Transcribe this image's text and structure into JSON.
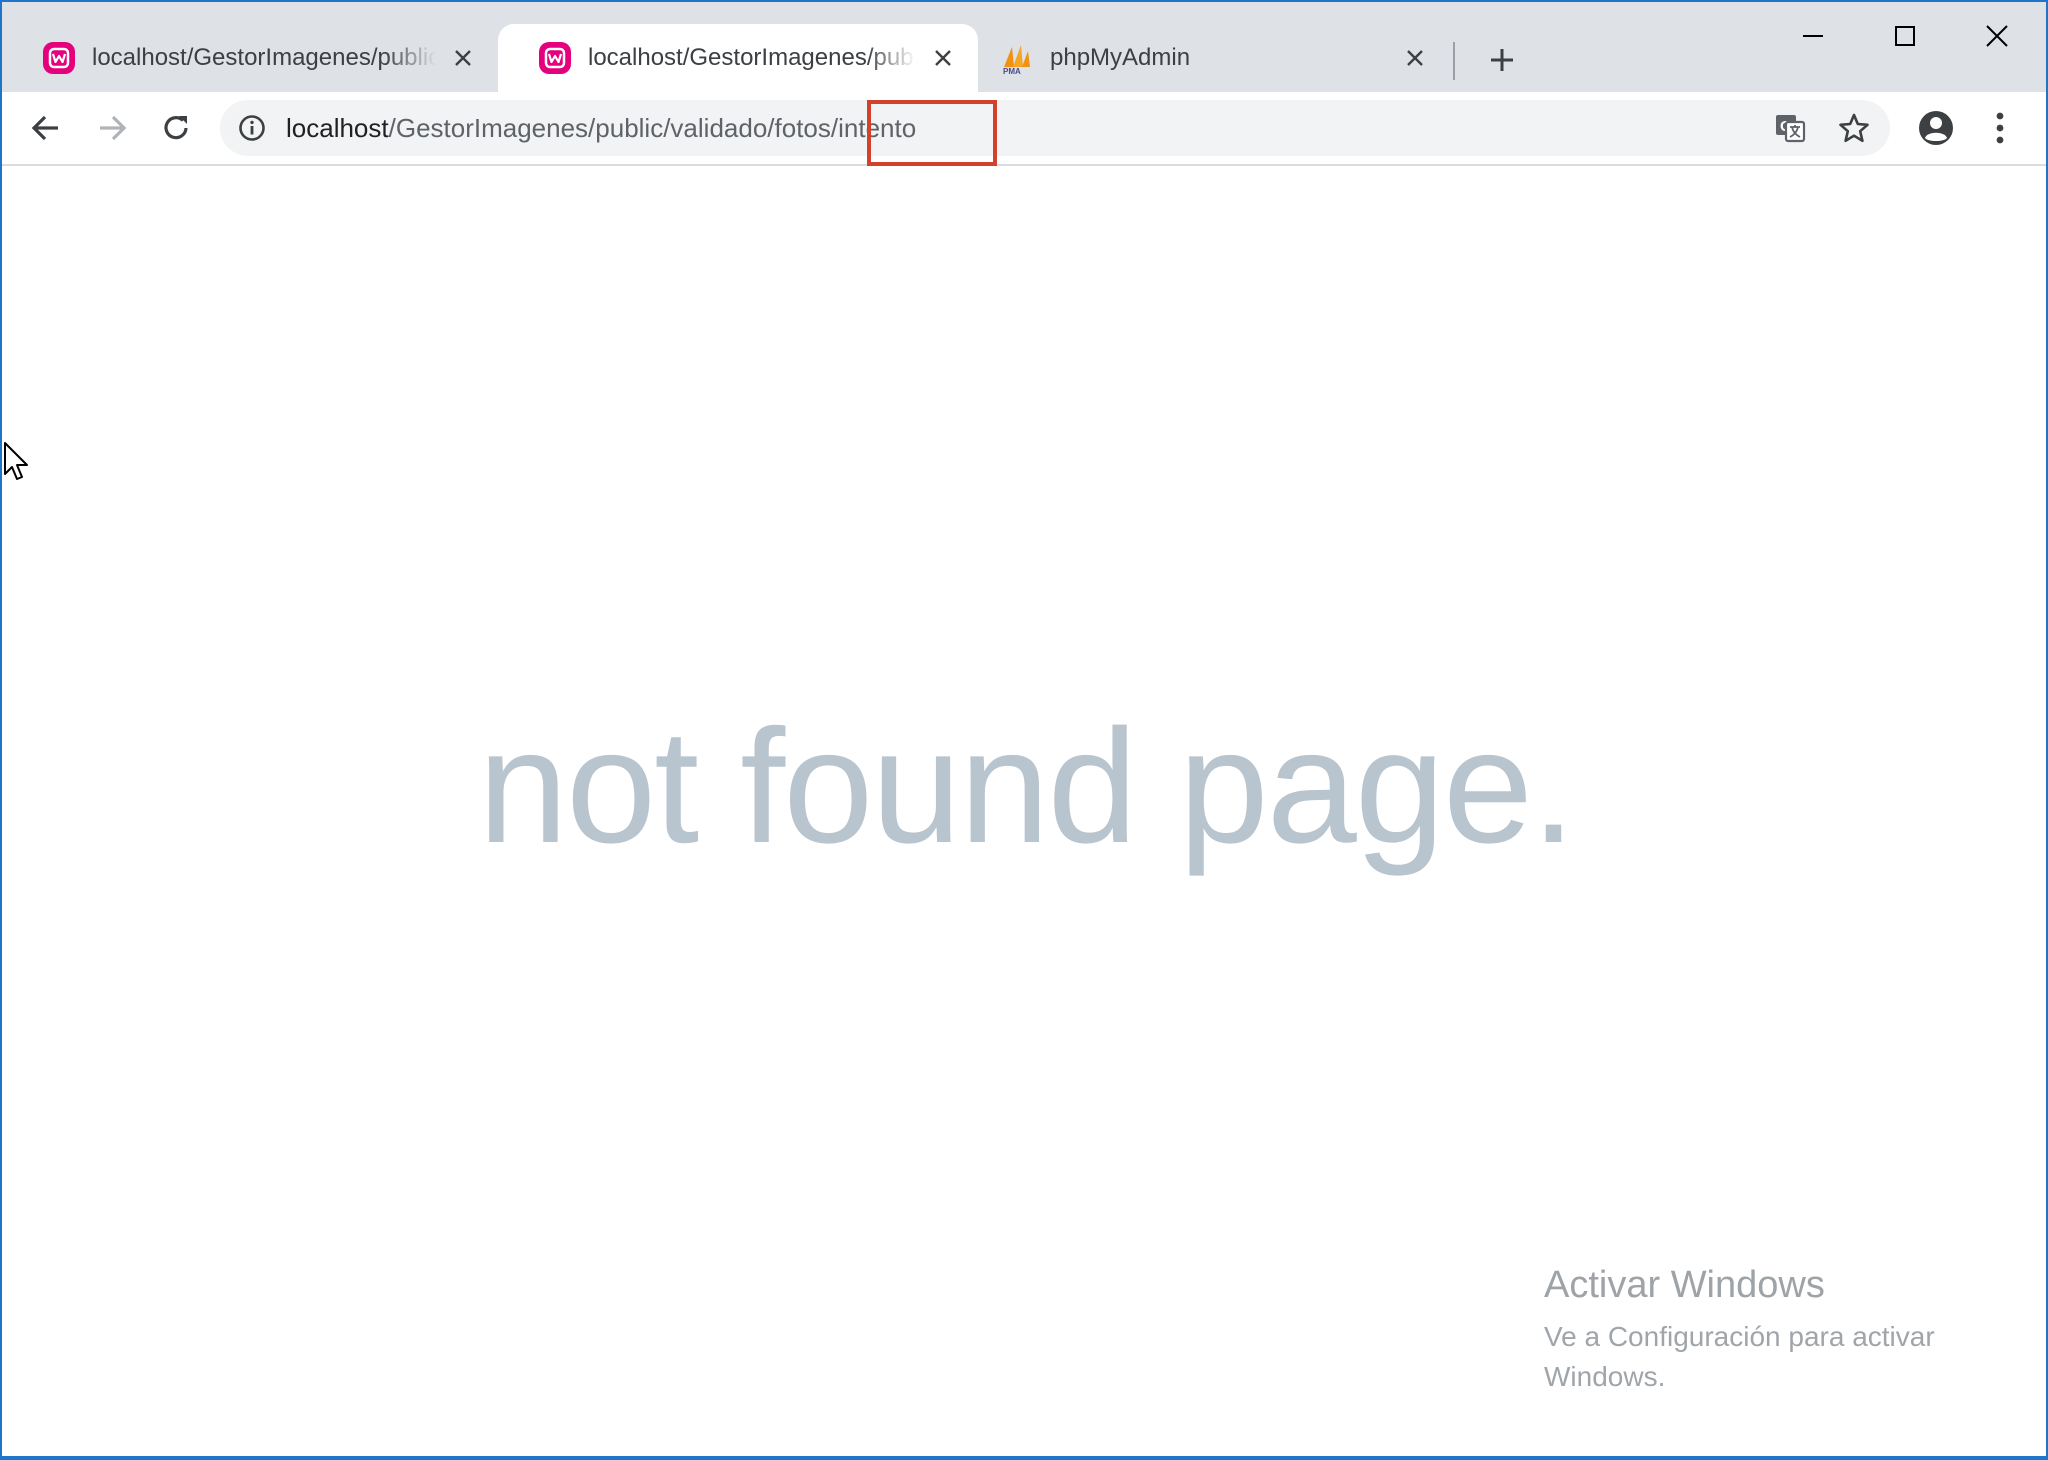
{
  "tabs": [
    {
      "title": "localhost/GestorImagenes/public",
      "favicon": "wamp-icon",
      "active": false
    },
    {
      "title": "localhost/GestorImagenes/public",
      "favicon": "wamp-icon",
      "active": true
    },
    {
      "title": "phpMyAdmin",
      "favicon": "phpmyadmin-icon",
      "active": false
    }
  ],
  "toolbar": {
    "url_host": "localhost",
    "url_path": "/GestorImagenes/public/validado/fotos/intento"
  },
  "page": {
    "message": "not found page."
  },
  "watermark": {
    "title": "Activar Windows",
    "subtitle": "Ve a Configuración para activar Windows."
  },
  "colors": {
    "wamp": "#e5007e",
    "window_border": "#1f76c9",
    "highlight": "#d4402e",
    "tabstrip": "#dee1e6"
  }
}
